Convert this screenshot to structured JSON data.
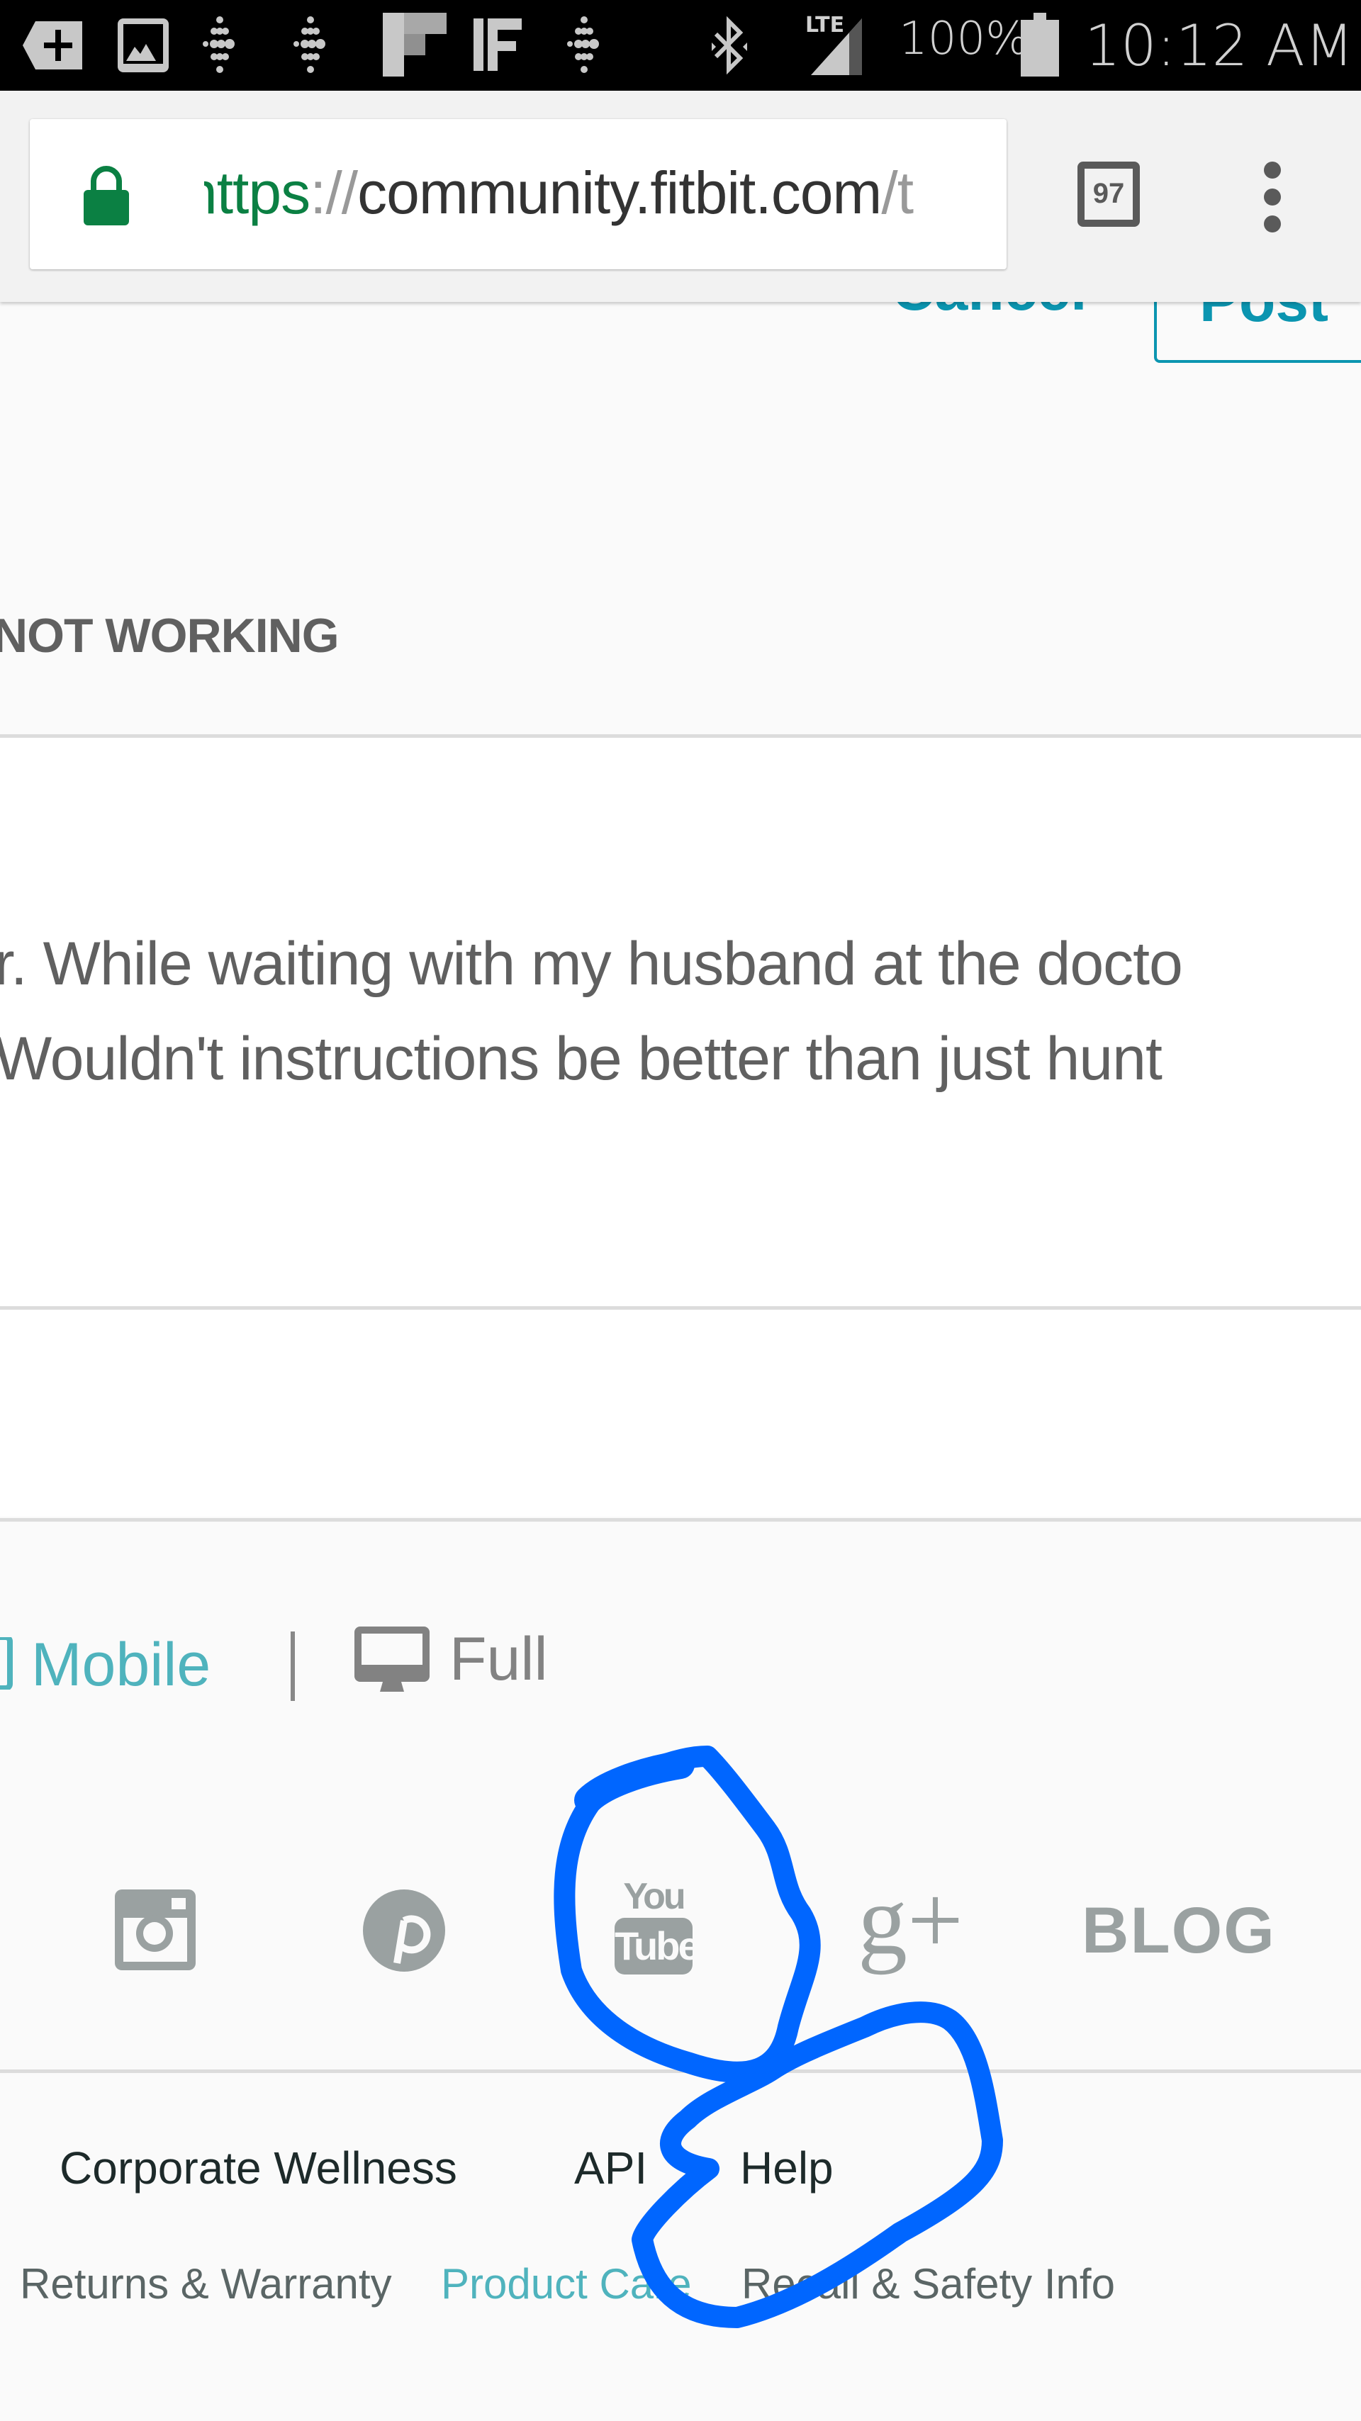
{
  "status_bar": {
    "notification_icons": [
      "add-tab-icon",
      "gallery-icon",
      "fitbit-icon",
      "fitbit-icon",
      "flipboard-icon",
      "ifttt-icon",
      "fitbit-icon"
    ],
    "network_label": "LTE",
    "battery_percent": "100%",
    "time": "10:12 AM"
  },
  "browser": {
    "url_scheme": "https",
    "url_separator": "://",
    "url_host": "community.fitbit.com",
    "url_path": "/t",
    "tab_count": "97",
    "secure": true
  },
  "post_actions": {
    "cancel_label": "Cancel",
    "post_label": "Post"
  },
  "thread": {
    "subject_fragment": "NOT WORKING",
    "body_lines": [
      "r. While waiting with my husband at the docto",
      " Wouldn't instructions be better than just hunt"
    ]
  },
  "footer": {
    "view_mobile_label": "Mobile",
    "view_separator": "|",
    "view_full_label": "Full",
    "social": [
      {
        "name": "instagram"
      },
      {
        "name": "pinterest"
      },
      {
        "name": "youtube",
        "label_top": "You",
        "label_bottom": "Tube"
      },
      {
        "name": "google-plus",
        "label": "g+"
      }
    ],
    "blog_label": "BLOG",
    "links_row1": [
      "Corporate Wellness",
      "API",
      "Help"
    ],
    "links_row2": [
      "Returns & Warranty",
      "Product Care",
      "Recall & Safety Info"
    ],
    "accent_color": "#4fb3bd",
    "annotation_color": "#0066ff"
  }
}
